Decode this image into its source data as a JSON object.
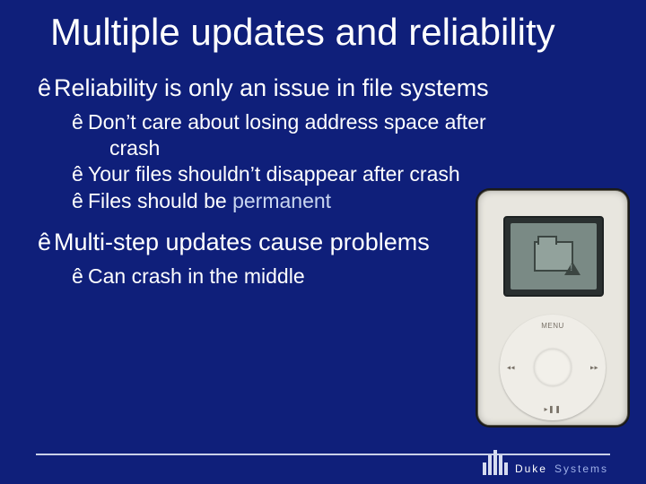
{
  "title": "Multiple updates and reliability",
  "bullets": {
    "b1": {
      "text": "Reliability is only an issue in file systems",
      "sub": [
        {
          "line": "Don’t care about losing address space after",
          "cont": "crash"
        },
        {
          "line": "Your files shouldn’t disappear after crash"
        },
        {
          "line_prefix": "Files should be ",
          "highlight": "permanent"
        }
      ]
    },
    "b2": {
      "text": "Multi-step updates cause problems",
      "sub": [
        {
          "line": "Can crash in the middle"
        }
      ]
    }
  },
  "bullet_glyph": "ê",
  "device": {
    "wheel": {
      "menu": "MENU",
      "prev": "◂◂",
      "next": "▸▸",
      "play": "▸❚❚"
    }
  },
  "brand": {
    "word1": "Duke",
    "word2": "Systems"
  }
}
